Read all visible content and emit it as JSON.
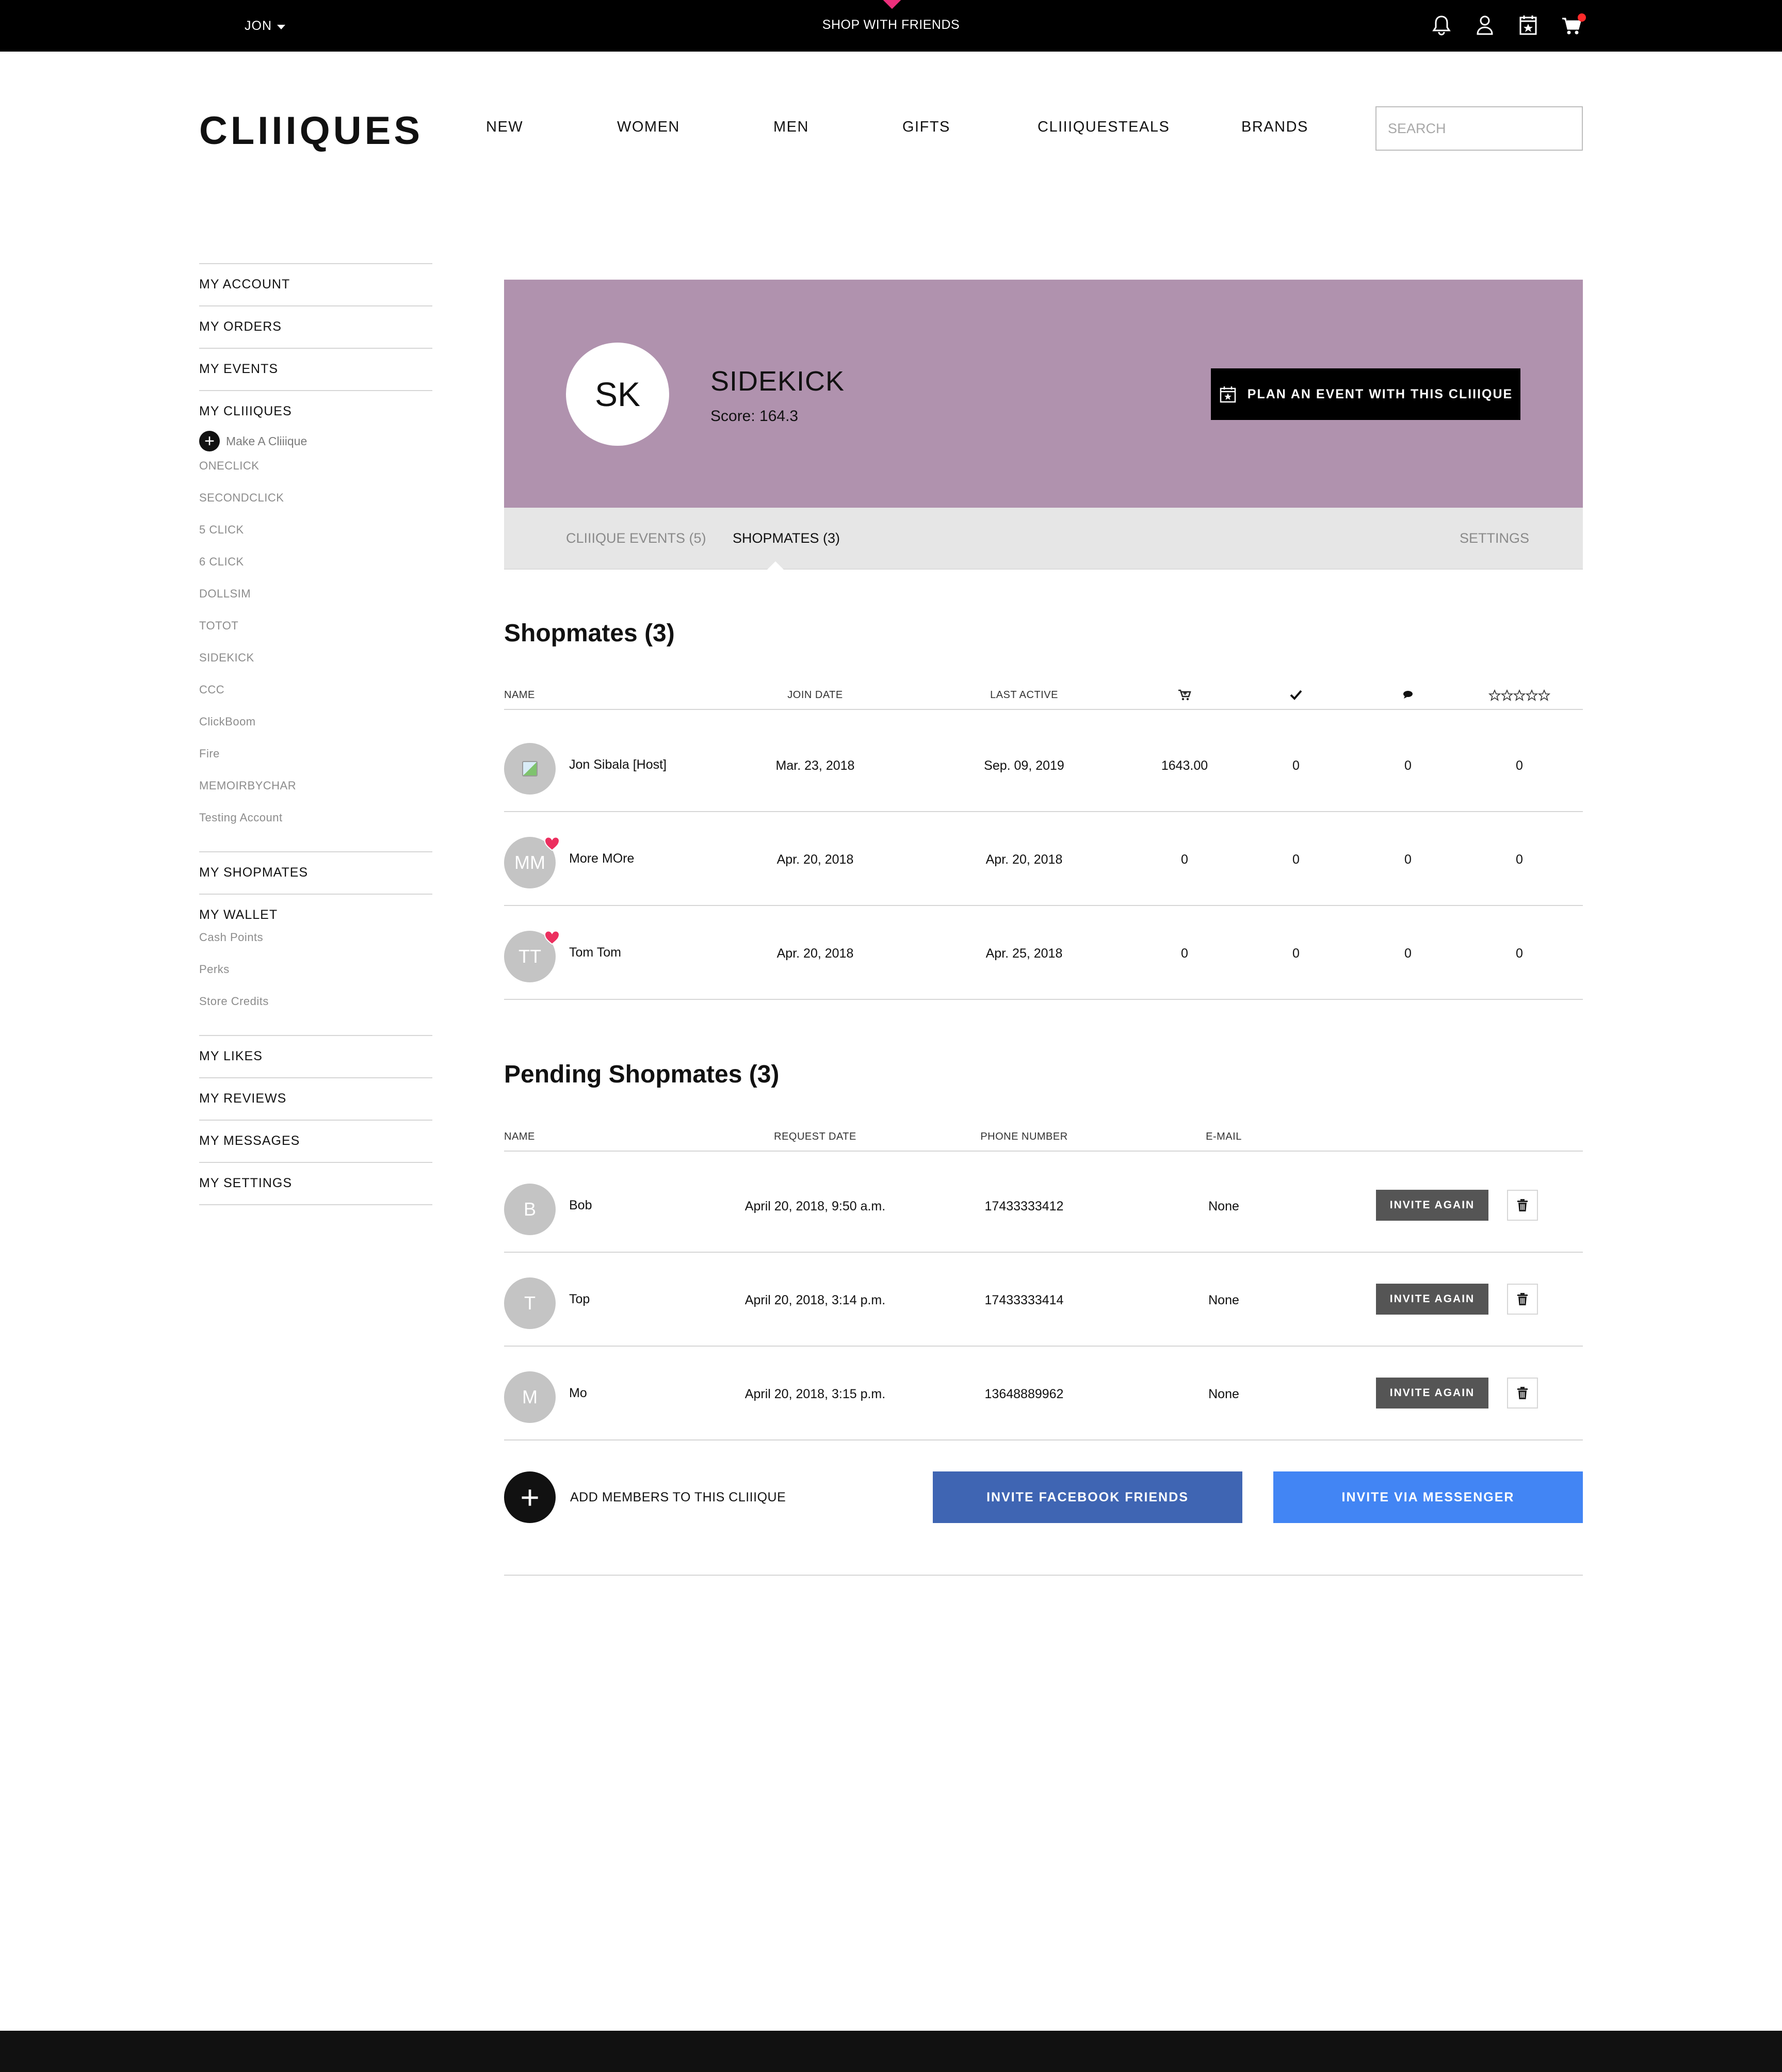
{
  "topbar": {
    "user": "JON",
    "promo": "SHOP WITH FRIENDS",
    "icons": [
      "bell-icon",
      "user-icon",
      "calendar-star-icon",
      "cart-icon"
    ]
  },
  "header": {
    "logo": "CLIIIQUES",
    "nav": [
      "NEW",
      "WOMEN",
      "MEN",
      "GIFTS",
      "CLIIIQUESTEALS",
      "BRANDS"
    ],
    "search_placeholder": "SEARCH"
  },
  "sidebar": {
    "my_account": "MY ACCOUNT",
    "my_orders": "MY ORDERS",
    "my_events": "MY EVENTS",
    "my_cliiiques": "MY CLIIIQUES",
    "make_cliiique": "Make A Cliiique",
    "cliiiques": [
      "ONECLICK",
      "SECONDCLICK",
      "5 CLICK",
      "6 CLICK",
      "DOLLSIM",
      "TOTOT",
      "SIDEKICK",
      "CCC",
      "ClickBoom",
      "Fire",
      "MEMOIRBYCHAR",
      "Testing Account"
    ],
    "my_shopmates": "MY SHOPMATES",
    "my_wallet": "MY WALLET",
    "wallet_items": [
      "Cash Points",
      "Perks",
      "Store Credits"
    ],
    "my_likes": "MY LIKES",
    "my_reviews": "MY REVIEWS",
    "my_messages": "MY MESSAGES",
    "my_settings": "MY SETTINGS"
  },
  "banner": {
    "initials": "SK",
    "name": "SIDEKICK",
    "score": "Score: 164.3",
    "plan_button": "PLAN AN EVENT WITH THIS CLIIIQUE",
    "color": "#b092ae"
  },
  "tabs": {
    "events": "CLIIIQUE EVENTS (5)",
    "shopmates": "SHOPMATES (3)",
    "settings": "SETTINGS",
    "active": "shopmates"
  },
  "shopmates": {
    "title": "Shopmates (3)",
    "headers": {
      "name": "NAME",
      "join_date": "JOIN DATE",
      "last_active": "LAST ACTIVE",
      "icons": [
        "cart-icon",
        "check-icon",
        "speech-bubble-icon",
        "stars-icon"
      ]
    },
    "rows": [
      {
        "avatar": "",
        "name": "Jon Sibala [Host]",
        "join": "Mar. 23, 2018",
        "last": "Sep. 09, 2019",
        "spent": "1643.00",
        "checks": "0",
        "comments": "0",
        "rating": "0",
        "heart": false
      },
      {
        "avatar": "MM",
        "name": "More MOre",
        "join": "Apr. 20, 2018",
        "last": "Apr. 20, 2018",
        "spent": "0",
        "checks": "0",
        "comments": "0",
        "rating": "0",
        "heart": true
      },
      {
        "avatar": "TT",
        "name": "Tom Tom",
        "join": "Apr. 20, 2018",
        "last": "Apr. 25, 2018",
        "spent": "0",
        "checks": "0",
        "comments": "0",
        "rating": "0",
        "heart": true
      }
    ]
  },
  "pending": {
    "title": "Pending Shopmates (3)",
    "headers": {
      "name": "NAME",
      "request_date": "REQUEST DATE",
      "phone": "PHONE NUMBER",
      "email": "E-MAIL"
    },
    "invite_label": "INVITE AGAIN",
    "rows": [
      {
        "avatar": "B",
        "name": "Bob",
        "date": "April 20, 2018, 9:50 a.m.",
        "phone": "17433333412",
        "email": "None"
      },
      {
        "avatar": "T",
        "name": "Top",
        "date": "April 20, 2018, 3:14 p.m.",
        "phone": "17433333414",
        "email": "None"
      },
      {
        "avatar": "M",
        "name": "Mo",
        "date": "April 20, 2018, 3:15 p.m.",
        "phone": "13648889962",
        "email": "None"
      }
    ]
  },
  "actions": {
    "add_members": "ADD MEMBERS TO THIS CLIIIQUE",
    "facebook": "INVITE FACEBOOK FRIENDS",
    "messenger": "INVITE VIA MESSENGER",
    "facebook_color": "#3f65b3",
    "messenger_color": "#4285f4"
  }
}
